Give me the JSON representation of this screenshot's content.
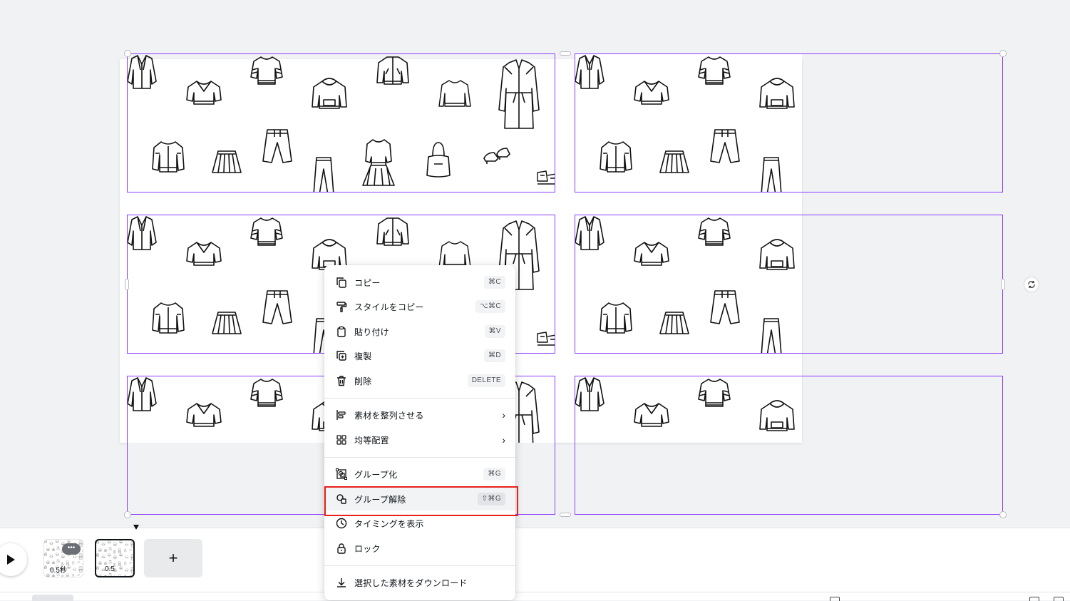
{
  "canvas": {
    "accent_color": "#8b3dff"
  },
  "context_menu": {
    "items": [
      {
        "label": "コピー",
        "shortcut": "⌘C",
        "icon": "copy-icon"
      },
      {
        "label": "スタイルをコピー",
        "shortcut": "⌥⌘C",
        "icon": "paint-roller-icon"
      },
      {
        "label": "貼り付け",
        "shortcut": "⌘V",
        "icon": "clipboard-icon"
      },
      {
        "label": "複製",
        "shortcut": "⌘D",
        "icon": "duplicate-icon"
      },
      {
        "label": "削除",
        "shortcut": "DELETE",
        "icon": "trash-icon"
      },
      {
        "label": "素材を整列させる",
        "shortcut": "",
        "icon": "align-icon",
        "submenu": true
      },
      {
        "label": "均等配置",
        "shortcut": "",
        "icon": "grid-icon",
        "submenu": true
      },
      {
        "label": "グループ化",
        "shortcut": "⌘G",
        "icon": "group-icon"
      },
      {
        "label": "グループ解除",
        "shortcut": "⇧⌘G",
        "icon": "ungroup-icon",
        "highlighted": true
      },
      {
        "label": "タイミングを表示",
        "shortcut": "",
        "icon": "clock-icon"
      },
      {
        "label": "ロック",
        "shortcut": "",
        "icon": "lock-icon"
      },
      {
        "label": "選択した素材をダウンロード",
        "shortcut": "",
        "icon": "download-icon"
      }
    ],
    "highlight_color": "#e8211c"
  },
  "timeline": {
    "pages": [
      {
        "duration": "0.5秒",
        "more": "•••"
      },
      {
        "duration": "0.5"
      }
    ],
    "add_label": "+"
  }
}
